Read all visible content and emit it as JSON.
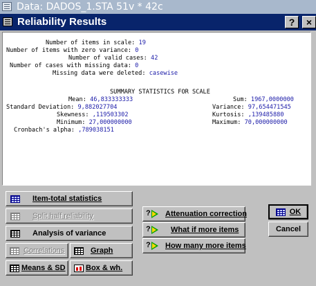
{
  "window": {
    "title": "Data: DADOS_1.STA 51v * 42c"
  },
  "dialog": {
    "title": "Reliability Results",
    "help_label": "?",
    "close_label": "×"
  },
  "summary": {
    "n_items_label": "Number of items in scale:",
    "n_items": "19",
    "zero_var_label": "Number of items with zero variance:",
    "zero_var": "0",
    "valid_cases_label": "Number of valid cases:",
    "valid_cases": "42",
    "missing_cases_label": "Number of cases with missing data:",
    "missing_cases": "0",
    "missing_deleted_label": "Missing data were deleted:",
    "missing_deleted": "casewise"
  },
  "stats": {
    "header": "SUMMARY STATISTICS FOR SCALE",
    "mean_label": "Mean:",
    "mean": "46,833333333",
    "sum_label": "Sum:",
    "sum": "1967,0000000",
    "sd_label": "Standard Deviation:",
    "sd": "9,882027704",
    "variance_label": "Variance:",
    "variance": "97,654471545",
    "skewness_label": "Skewness:",
    "skewness": ",119503302",
    "kurtosis_label": "Kurtosis:",
    "kurtosis": ",139485880",
    "minimum_label": "Minimum:",
    "minimum": "27,000000000",
    "maximum_label": "Maximum:",
    "maximum": "70,000000000",
    "alpha_label": "Cronbach's alpha:",
    "alpha": ",789038151"
  },
  "buttons": {
    "item_total": "Item-total statistics",
    "split_half": "Split half reliability",
    "anova": "Analysis of variance",
    "correlations": "Correlations",
    "graph": "Graph",
    "means_sd": "Means & SD",
    "box_wh": "Box & wh.",
    "attenuation": "Attenuation correction",
    "what_if": "What if more items",
    "how_many": "How many more items",
    "ok": "OK",
    "cancel": "Cancel",
    "q_mark": "?"
  },
  "colors": {
    "dialog_title_bg": "#08246b",
    "value_text": "#1a1aa8",
    "face": "#c0c0c0"
  }
}
